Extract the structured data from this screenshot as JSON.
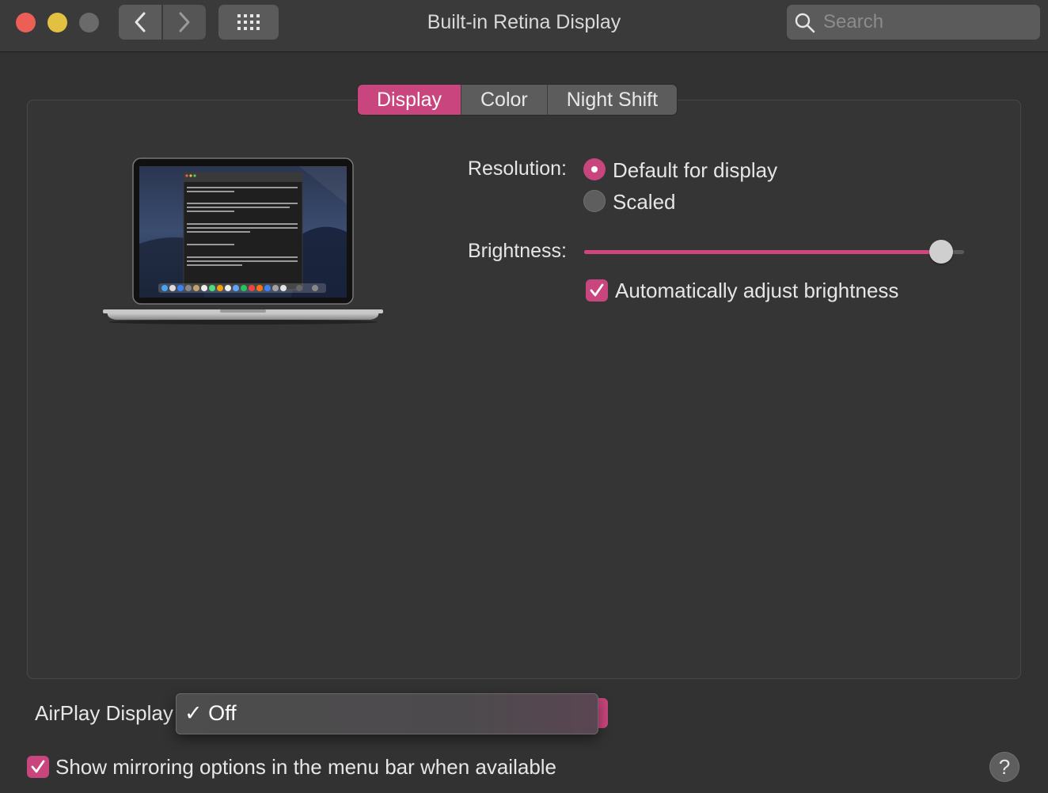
{
  "window": {
    "title": "Built-in Retina Display",
    "search_placeholder": "Search"
  },
  "tabs": [
    {
      "label": "Display",
      "active": true
    },
    {
      "label": "Color",
      "active": false
    },
    {
      "label": "Night Shift",
      "active": false
    }
  ],
  "display": {
    "resolution_label": "Resolution:",
    "resolution_options": [
      {
        "label": "Default for display",
        "selected": true
      },
      {
        "label": "Scaled",
        "selected": false
      }
    ],
    "brightness_label": "Brightness:",
    "brightness_level": 0.94,
    "auto_brightness_label": "Automatically adjust brightness",
    "auto_brightness_checked": true
  },
  "airplay": {
    "label": "AirPlay Display",
    "selected_value": "✓ Off"
  },
  "mirroring": {
    "label": "Show mirroring options in the menu bar when available",
    "checked": true
  },
  "help_label": "?",
  "colors": {
    "accent": "#c8467d",
    "background": "#323232"
  }
}
